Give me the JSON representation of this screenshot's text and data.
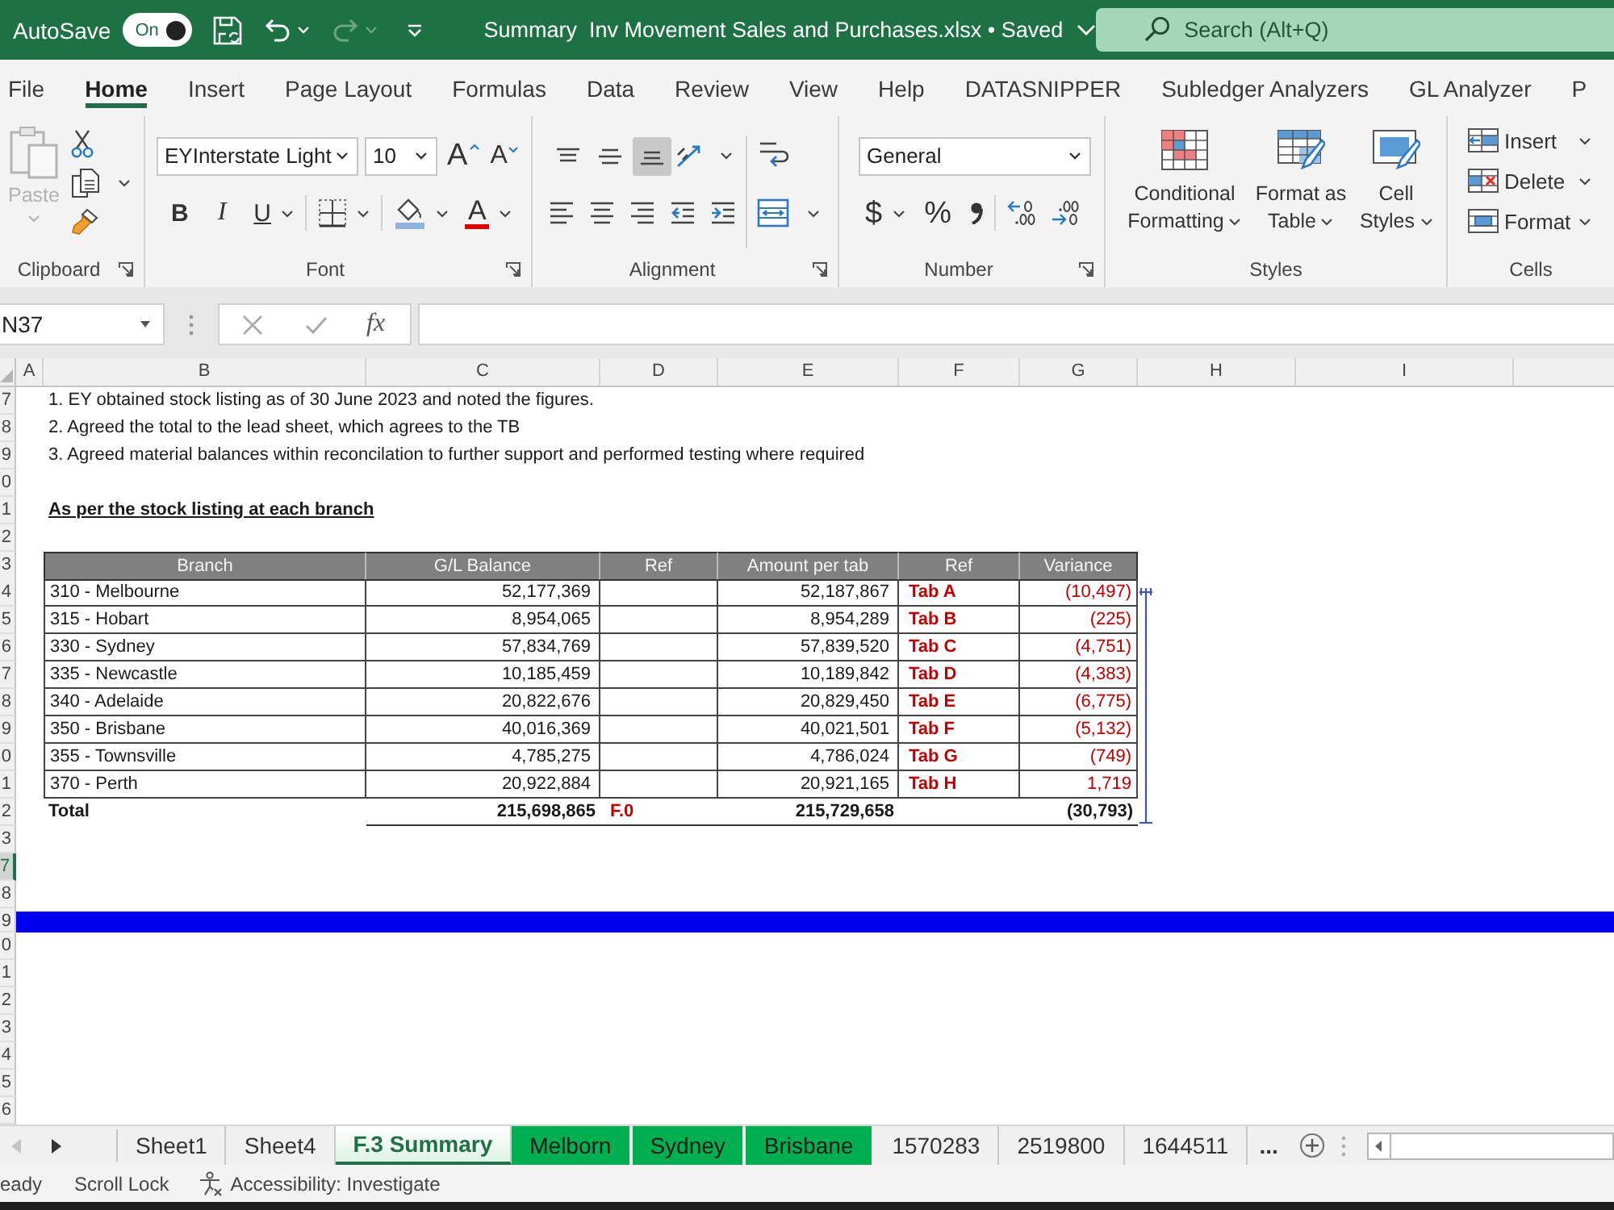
{
  "title_bar": {
    "autosave": {
      "label": "AutoSave",
      "toggle_text": "On",
      "on": true
    },
    "undo": {
      "disabled": false
    },
    "redo": {
      "disabled": true
    },
    "title": "Summary  Inv Movement Sales and Purchases.xlsx • Saved",
    "search": {
      "placeholder": "Search (Alt+Q)"
    }
  },
  "ribbon_tabs": [
    {
      "label": "File",
      "selected": false
    },
    {
      "label": "Home",
      "selected": true
    },
    {
      "label": "Insert",
      "selected": false
    },
    {
      "label": "Page Layout",
      "selected": false
    },
    {
      "label": "Formulas",
      "selected": false
    },
    {
      "label": "Data",
      "selected": false
    },
    {
      "label": "Review",
      "selected": false
    },
    {
      "label": "View",
      "selected": false
    },
    {
      "label": "Help",
      "selected": false
    },
    {
      "label": "DATASNIPPER",
      "selected": false
    },
    {
      "label": "Subledger Analyzers",
      "selected": false
    },
    {
      "label": "GL Analyzer",
      "selected": false
    },
    {
      "label": "P",
      "selected": false
    }
  ],
  "clipboard": {
    "label": "Clipboard",
    "paste": {
      "label": "Paste",
      "disabled": true
    }
  },
  "font": {
    "label": "Font",
    "font_name": "EYInterstate Light",
    "font_size": "10",
    "grow_font": "A",
    "shrink_font": "A",
    "bold": "B",
    "italic": "I",
    "underline": "U",
    "font_color": "A"
  },
  "alignment": {
    "label": "Alignment",
    "vertical": [
      {
        "selected": false
      },
      {
        "selected": false
      },
      {
        "selected": true
      }
    ]
  },
  "number": {
    "label": "Number",
    "format": "General",
    "currency": "$",
    "percent": "%"
  },
  "styles": {
    "label": "Styles",
    "buttons": [
      {
        "lines": [
          "Conditional",
          "Formatting"
        ]
      },
      {
        "lines": [
          "Format as",
          "Table"
        ]
      },
      {
        "lines": [
          "Cell",
          "Styles"
        ]
      }
    ]
  },
  "cells": {
    "label": "Cells",
    "buttons": [
      "Insert",
      "Delete",
      "Format"
    ]
  },
  "formula_bar": {
    "name_box": "N37",
    "function_button": "fx"
  },
  "columns": [
    "A",
    "B",
    "C",
    "D",
    "E",
    "F",
    "G",
    "H",
    "I"
  ],
  "rows": [
    {
      "num": "7",
      "selected": false,
      "kind": "note",
      "text": "1. EY obtained stock listing as of 30 June 2023 and noted the figures."
    },
    {
      "num": "8",
      "selected": false,
      "kind": "note",
      "text": "2. Agreed the total to the lead sheet, which agrees to the TB"
    },
    {
      "num": "9",
      "selected": false,
      "kind": "note",
      "text": "3. Agreed material balances within reconcilation to further support and performed testing where required"
    },
    {
      "num": "0",
      "selected": false,
      "kind": "blank"
    },
    {
      "num": "1",
      "selected": false,
      "kind": "heading",
      "text": "As per the stock listing at each branch"
    },
    {
      "num": "2",
      "selected": false,
      "kind": "blank"
    },
    {
      "num": "3",
      "selected": false,
      "kind": "table_header",
      "cells": [
        "Branch",
        "G/L Balance",
        "Ref",
        "Amount per tab",
        "Ref",
        "Variance"
      ]
    },
    {
      "num": "4",
      "selected": false,
      "kind": "table_row",
      "branch": "310 - Melbourne",
      "gl_balance": "52,177,369",
      "amount_per_tab": "52,187,867",
      "ref": "Tab A",
      "variance": "(10,497)"
    },
    {
      "num": "5",
      "selected": false,
      "kind": "table_row",
      "branch": "315 - Hobart",
      "gl_balance": "8,954,065",
      "amount_per_tab": "8,954,289",
      "ref": "Tab B",
      "variance": "(225)"
    },
    {
      "num": "6",
      "selected": false,
      "kind": "table_row",
      "branch": "330 - Sydney",
      "gl_balance": "57,834,769",
      "amount_per_tab": "57,839,520",
      "ref": "Tab C",
      "variance": "(4,751)"
    },
    {
      "num": "7",
      "selected": false,
      "kind": "table_row",
      "branch": "335 - Newcastle",
      "gl_balance": "10,185,459",
      "amount_per_tab": "10,189,842",
      "ref": "Tab D",
      "variance": "(4,383)"
    },
    {
      "num": "8",
      "selected": false,
      "kind": "table_row",
      "branch": "340 - Adelaide",
      "gl_balance": "20,822,676",
      "amount_per_tab": "20,829,450",
      "ref": "Tab E",
      "variance": "(6,775)"
    },
    {
      "num": "9",
      "selected": false,
      "kind": "table_row",
      "branch": "350 - Brisbane",
      "gl_balance": "40,016,369",
      "amount_per_tab": "40,021,501",
      "ref": "Tab F",
      "variance": "(5,132)"
    },
    {
      "num": "0",
      "selected": false,
      "kind": "table_row",
      "branch": "355 - Townsville",
      "gl_balance": "4,785,275",
      "amount_per_tab": "4,786,024",
      "ref": "Tab G",
      "variance": "(749)"
    },
    {
      "num": "1",
      "selected": false,
      "kind": "table_row",
      "branch": "370 - Perth",
      "gl_balance": "20,922,884",
      "amount_per_tab": "20,921,165",
      "ref": "Tab H",
      "variance": "1,719"
    },
    {
      "num": "2",
      "selected": false,
      "kind": "total",
      "label": "Total",
      "gl_balance": "215,698,865",
      "gl_ref": "F.0",
      "amount_per_tab": "215,729,658",
      "variance": "(30,793)"
    },
    {
      "num": "3",
      "selected": false,
      "kind": "blank"
    },
    {
      "num": "7",
      "selected": true,
      "kind": "blank"
    },
    {
      "num": "8",
      "selected": false,
      "kind": "blank"
    },
    {
      "num": "9",
      "selected": false,
      "kind": "band"
    },
    {
      "num": "0",
      "selected": false,
      "kind": "blank"
    },
    {
      "num": "1",
      "selected": false,
      "kind": "blank"
    },
    {
      "num": "2",
      "selected": false,
      "kind": "blank"
    },
    {
      "num": "3",
      "selected": false,
      "kind": "blank"
    },
    {
      "num": "4",
      "selected": false,
      "kind": "blank"
    },
    {
      "num": "5",
      "selected": false,
      "kind": "blank"
    },
    {
      "num": "6",
      "selected": false,
      "kind": "blank"
    }
  ],
  "sheet_nav": {
    "previous": {
      "disabled": true
    },
    "next": {
      "disabled": false
    }
  },
  "sheet_tabs": [
    {
      "label": "Sheet1",
      "selected": false
    },
    {
      "label": "Sheet4",
      "selected": false
    },
    {
      "label": "F.3 Summary",
      "selected": true
    },
    {
      "label": "Melborn",
      "selected": false,
      "color": "#00b050"
    },
    {
      "label": "Sydney",
      "selected": false,
      "color": "#00b050"
    },
    {
      "label": "Brisbane",
      "selected": false,
      "color": "#00b050"
    },
    {
      "label": "1570283",
      "selected": false
    },
    {
      "label": "2519800",
      "selected": false
    },
    {
      "label": "1644511",
      "selected": false
    }
  ],
  "more_sheets": "...",
  "status_bar": [
    {
      "kind": "text",
      "text": "eady"
    },
    {
      "kind": "text",
      "text": "Scroll Lock"
    },
    {
      "kind": "accessibility",
      "text": "Accessibility: Investigate"
    }
  ]
}
